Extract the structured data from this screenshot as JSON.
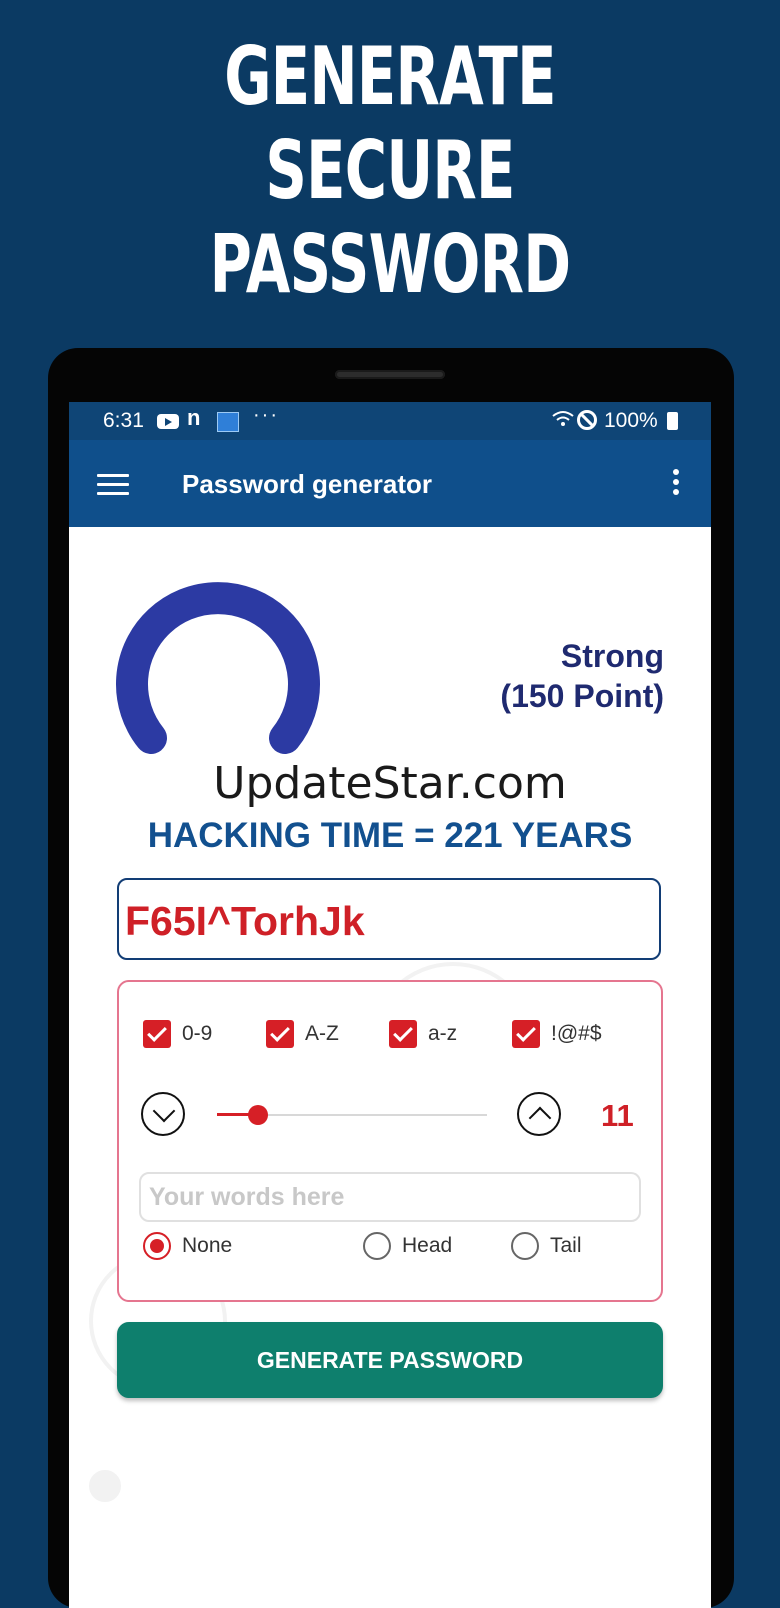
{
  "promo": {
    "line1": "GENERATE",
    "line2": "SECURE",
    "line3": "PASSWORD"
  },
  "status_bar": {
    "time": "6:31",
    "battery": "100%",
    "dots": "···"
  },
  "app_bar": {
    "title": "Password generator"
  },
  "strength": {
    "label": "Strong",
    "points": "(150 Point)"
  },
  "watermark": "UpdateStar.com",
  "hacking_time": "HACKING TIME = 221 YEARS",
  "password": "F65I^TorhJk",
  "charsets": [
    {
      "label": "0-9",
      "checked": true
    },
    {
      "label": "A-Z",
      "checked": true
    },
    {
      "label": "a-z",
      "checked": true
    },
    {
      "label": "!@#$",
      "checked": true
    }
  ],
  "length": {
    "value": "11",
    "slider_fraction": 0.15
  },
  "words": {
    "placeholder": "Your words here",
    "value": ""
  },
  "position_options": [
    {
      "label": "None",
      "selected": true
    },
    {
      "label": "Head",
      "selected": false
    },
    {
      "label": "Tail",
      "selected": false
    }
  ],
  "generate_button": "GENERATE PASSWORD",
  "colors": {
    "background": "#0b3a63",
    "app_bar": "#0f4f8b",
    "gauge": "#2c3aa3",
    "accent_red": "#d61f26",
    "button_teal": "#0e7f6d"
  }
}
